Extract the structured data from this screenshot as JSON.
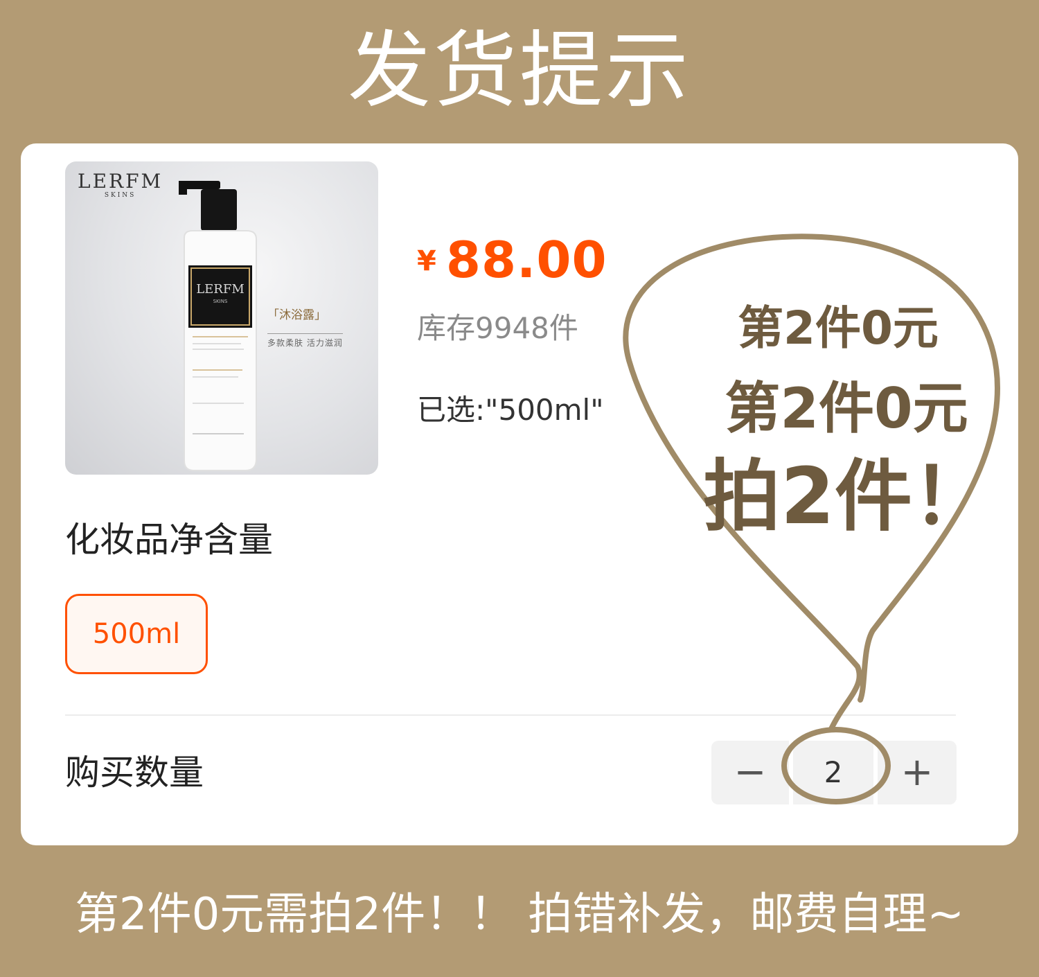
{
  "header": {
    "title": "发货提示"
  },
  "product": {
    "brand_logo": "LERFM",
    "brand_sub": "SKINS",
    "bottle_tag": "「沐浴露」",
    "bottle_subtag": "多款柔肤 活力滋润",
    "price_symbol": "¥",
    "price": "88.00",
    "stock": "库存9948件",
    "selected": "已选:\"500ml\""
  },
  "spec": {
    "title": "化妆品净含量",
    "options": [
      {
        "label": "500ml",
        "selected": true
      }
    ]
  },
  "quantity": {
    "label": "购买数量",
    "minus": "−",
    "value": "2",
    "plus": "+"
  },
  "callout": {
    "line1": "第2件0元",
    "line2": "第2件0元",
    "line3": "拍2件！"
  },
  "footer": {
    "note": "第2件0元需拍2件！！ 拍错补发，邮费自理~"
  },
  "colors": {
    "background": "#b39b74",
    "accent": "#ff5000",
    "callout_outline": "#a08b67",
    "callout_text": "#6e5b3f"
  }
}
